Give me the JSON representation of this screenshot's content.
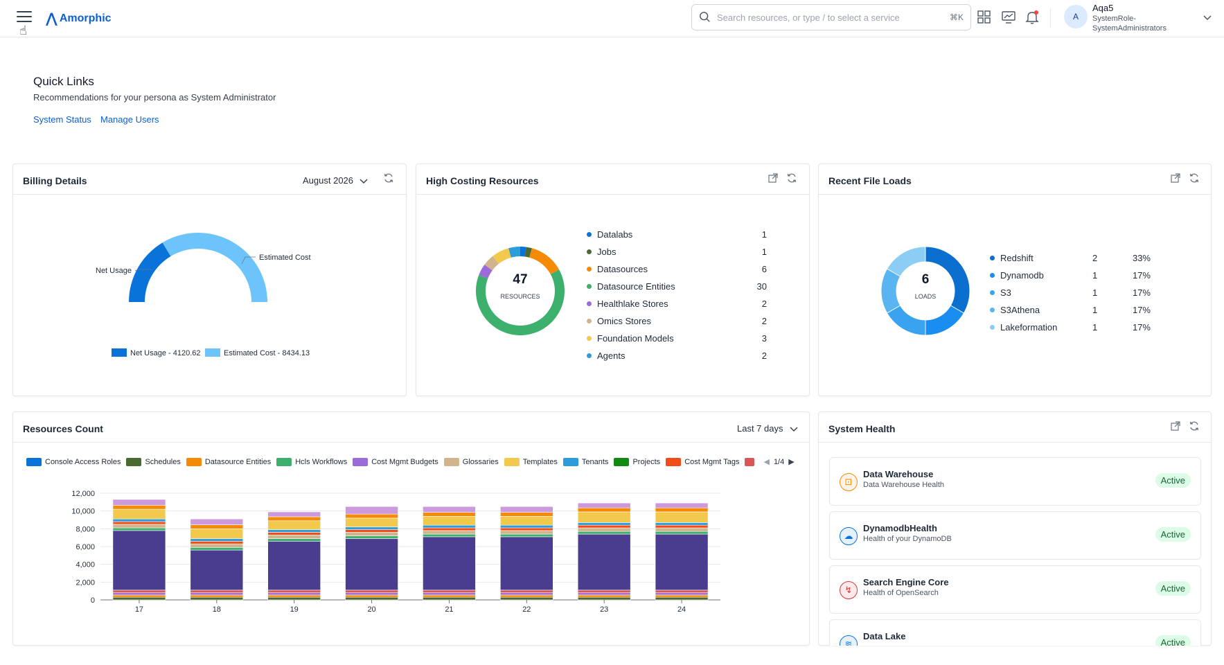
{
  "header": {
    "app_name": "Amorphic",
    "search_placeholder": "Search resources, or type / to select a service",
    "search_shortcut": "⌘K",
    "user": {
      "initial": "A",
      "name": "Aqa5",
      "role": "SystemRole-SystemAdministrators"
    }
  },
  "quick_links": {
    "title": "Quick Links",
    "subtitle": "Recommendations for your persona as System Administrator",
    "links": [
      "System Status",
      "Manage Users"
    ]
  },
  "billing": {
    "title": "Billing Details",
    "period": "August 2026",
    "label_net": "Net Usage",
    "label_est": "Estimated Cost",
    "legend_net": "Net Usage - 4120.62",
    "legend_est": "Estimated Cost - 8434.13",
    "colors": {
      "net": "#0a73d9",
      "est": "#6cc4fb"
    }
  },
  "high_costing": {
    "title": "High Costing Resources",
    "total": "47",
    "total_label": "RESOURCES",
    "items": [
      {
        "name": "Datalabs",
        "value": "1",
        "color": "#0a73d9"
      },
      {
        "name": "Jobs",
        "value": "1",
        "color": "#4a6b2f"
      },
      {
        "name": "Datasources",
        "value": "6",
        "color": "#f58a07"
      },
      {
        "name": "Datasource Entities",
        "value": "30",
        "color": "#3cb06c"
      },
      {
        "name": "Healthlake Stores",
        "value": "2",
        "color": "#9b6bdc"
      },
      {
        "name": "Omics Stores",
        "value": "2",
        "color": "#d2b48c"
      },
      {
        "name": "Foundation Models",
        "value": "3",
        "color": "#f2c94c"
      },
      {
        "name": "Agents",
        "value": "2",
        "color": "#2d9cdb"
      }
    ]
  },
  "recent_loads": {
    "title": "Recent File Loads",
    "total": "6",
    "total_label": "LOADS",
    "items": [
      {
        "name": "Redshift",
        "value": "2",
        "pct": "33%",
        "color": "#0a6fcf"
      },
      {
        "name": "Dynamodb",
        "value": "1",
        "pct": "17%",
        "color": "#1a8ef0"
      },
      {
        "name": "S3",
        "value": "1",
        "pct": "17%",
        "color": "#3aa3ef"
      },
      {
        "name": "S3Athena",
        "value": "1",
        "pct": "17%",
        "color": "#5ab4f2"
      },
      {
        "name": "Lakeformation",
        "value": "1",
        "pct": "17%",
        "color": "#8ccdf6"
      }
    ]
  },
  "resources_count": {
    "title": "Resources Count",
    "period": "Last 7 days",
    "legend": [
      {
        "name": "Console Access Roles",
        "color": "#0a73d9"
      },
      {
        "name": "Schedules",
        "color": "#4a6b2f"
      },
      {
        "name": "Datasource Entities",
        "color": "#f58a07"
      },
      {
        "name": "Hcls Workflows",
        "color": "#3cb06c"
      },
      {
        "name": "Cost Mgmt Budgets",
        "color": "#9b6bdc"
      },
      {
        "name": "Glossaries",
        "color": "#d2b48c"
      },
      {
        "name": "Templates",
        "color": "#f2c94c"
      },
      {
        "name": "Tenants",
        "color": "#2d9cdb"
      },
      {
        "name": "Projects",
        "color": "#118a11"
      },
      {
        "name": "Cost Mgmt Tags",
        "color": "#f24c18"
      },
      {
        "name": "",
        "color": "#d95656"
      }
    ],
    "page_indicator": "1/4"
  },
  "chart_data": {
    "type": "bar",
    "stacked": true,
    "categories": [
      "17",
      "18",
      "19",
      "20",
      "21",
      "22",
      "23",
      "24"
    ],
    "ylim": [
      0,
      12000
    ],
    "yticks": [
      "0",
      "2,000",
      "4,000",
      "6,000",
      "8,000",
      "10,000",
      "12,000"
    ],
    "totals": [
      11800,
      10000,
      10700,
      11400,
      11600,
      11600,
      11800,
      11800
    ],
    "segments": [
      {
        "color": "#4a6b2f",
        "values": [
          300,
          300,
          300,
          300,
          300,
          300,
          300,
          300
        ]
      },
      {
        "color": "#f58a07",
        "values": [
          250,
          250,
          250,
          250,
          250,
          250,
          250,
          250
        ]
      },
      {
        "color": "#9b6bdc",
        "values": [
          250,
          250,
          250,
          250,
          250,
          250,
          250,
          250
        ]
      },
      {
        "color": "#d95656",
        "values": [
          300,
          300,
          300,
          300,
          300,
          300,
          300,
          300
        ]
      },
      {
        "color": "#4a3d8f",
        "values": [
          6700,
          4500,
          5500,
          5800,
          6000,
          6000,
          6300,
          6300
        ]
      },
      {
        "color": "#3cb06c",
        "values": [
          300,
          300,
          300,
          300,
          300,
          300,
          300,
          300
        ]
      },
      {
        "color": "#d2b48c",
        "values": [
          400,
          400,
          400,
          400,
          400,
          400,
          400,
          400
        ]
      },
      {
        "color": "#f24c18",
        "values": [
          300,
          300,
          300,
          300,
          300,
          300,
          300,
          300
        ]
      },
      {
        "color": "#2d9cdb",
        "values": [
          300,
          300,
          300,
          300,
          300,
          300,
          300,
          300
        ]
      },
      {
        "color": "#f2c94c",
        "values": [
          1100,
          1100,
          1000,
          1000,
          1000,
          1000,
          1200,
          1200
        ]
      },
      {
        "color": "#f58a07",
        "values": [
          450,
          450,
          450,
          450,
          450,
          450,
          450,
          450
        ]
      },
      {
        "color": "#cc99dd",
        "values": [
          650,
          650,
          550,
          850,
          650,
          650,
          550,
          550
        ]
      }
    ]
  },
  "system_health": {
    "title": "System Health",
    "items": [
      {
        "title": "Data Warehouse",
        "sub": "Data Warehouse Health",
        "status": "Active",
        "icon": "warehouse-icon",
        "color": "#f58a07",
        "bg": "#fff4e6"
      },
      {
        "title": "DynamodbHealth",
        "sub": "Health of your DynamoDB",
        "status": "Active",
        "icon": "database-icon",
        "color": "#0a73d9",
        "bg": "#e6f1fc"
      },
      {
        "title": "Search Engine Core",
        "sub": "Health of OpenSearch",
        "status": "Active",
        "icon": "search-engine-icon",
        "color": "#d93838",
        "bg": "#fdeaea"
      },
      {
        "title": "Data Lake",
        "sub": "",
        "status": "Active",
        "icon": "data-lake-icon",
        "color": "#0a73d9",
        "bg": "#e6f1fc"
      }
    ]
  }
}
